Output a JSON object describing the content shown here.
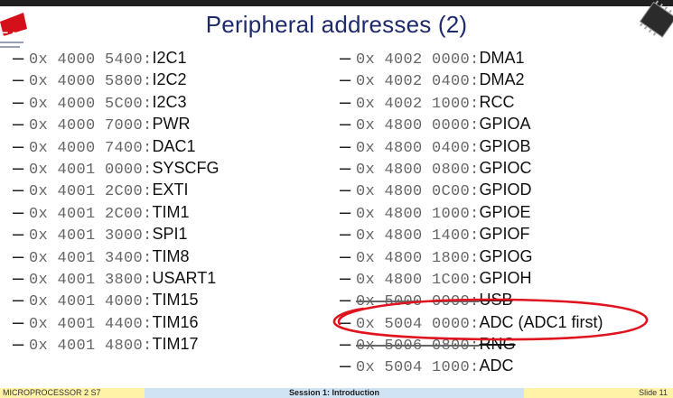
{
  "slide": {
    "title": "Peripheral addresses (2)",
    "logo_text": "EA"
  },
  "left_column": [
    {
      "address": "0x 4000 5400:",
      "name": "I2C1"
    },
    {
      "address": "0x 4000 5800:",
      "name": "I2C2"
    },
    {
      "address": "0x 4000 5C00:",
      "name": "I2C3"
    },
    {
      "address": "0x 4000 7000:",
      "name": "PWR"
    },
    {
      "address": "0x 4000 7400:",
      "name": "DAC1"
    },
    {
      "address": "0x 4001 0000:",
      "name": "SYSCFG"
    },
    {
      "address": "0x 4001 2C00:",
      "name": "EXTI"
    },
    {
      "address": "0x 4001 2C00:",
      "name": "TIM1"
    },
    {
      "address": "0x 4001 3000:",
      "name": "SPI1"
    },
    {
      "address": "0x 4001 3400:",
      "name": "TIM8"
    },
    {
      "address": "0x 4001 3800:",
      "name": "USART1"
    },
    {
      "address": "0x 4001 4000:",
      "name": "TIM15"
    },
    {
      "address": "0x 4001 4400:",
      "name": "TIM16"
    },
    {
      "address": "0x 4001 4800:",
      "name": "TIM17"
    }
  ],
  "right_column": [
    {
      "address": "0x 4002 0000:",
      "name": "DMA1"
    },
    {
      "address": "0x 4002 0400:",
      "name": "DMA2"
    },
    {
      "address": "0x 4002 1000:",
      "name": "RCC"
    },
    {
      "address": "0x 4800 0000:",
      "name": "GPIOA"
    },
    {
      "address": "0x 4800 0400:",
      "name": "GPIOB"
    },
    {
      "address": "0x 4800 0800:",
      "name": "GPIOC"
    },
    {
      "address": "0x 4800 0C00:",
      "name": "GPIOD"
    },
    {
      "address": "0x 4800 1000:",
      "name": "GPIOE"
    },
    {
      "address": "0x 4800 1400:",
      "name": "GPIOF"
    },
    {
      "address": "0x 4800 1800:",
      "name": "GPIOG"
    },
    {
      "address": "0x 4800 1C00:",
      "name": "GPIOH"
    },
    {
      "address": "0x 5000 0000:",
      "name": "USB",
      "struck": true
    },
    {
      "address": "0x 5004 0000:",
      "name": "ADC (ADC1 first)",
      "highlighted": true
    },
    {
      "address": "0x 5006 0800:",
      "name": "RNG",
      "struck": true
    },
    {
      "address": "0x 5004 1000:",
      "name": "ADC"
    }
  ],
  "footer": {
    "left": "MICROPROCESSOR 2 S7",
    "center": "Session 1: Introduction",
    "right": "Slide 11"
  },
  "colors": {
    "title": "#1f2a6b",
    "highlight_ellipse": "#e0141e",
    "footer_left_bg": "#fff3a8",
    "footer_center_bg": "#cfe3f5"
  }
}
